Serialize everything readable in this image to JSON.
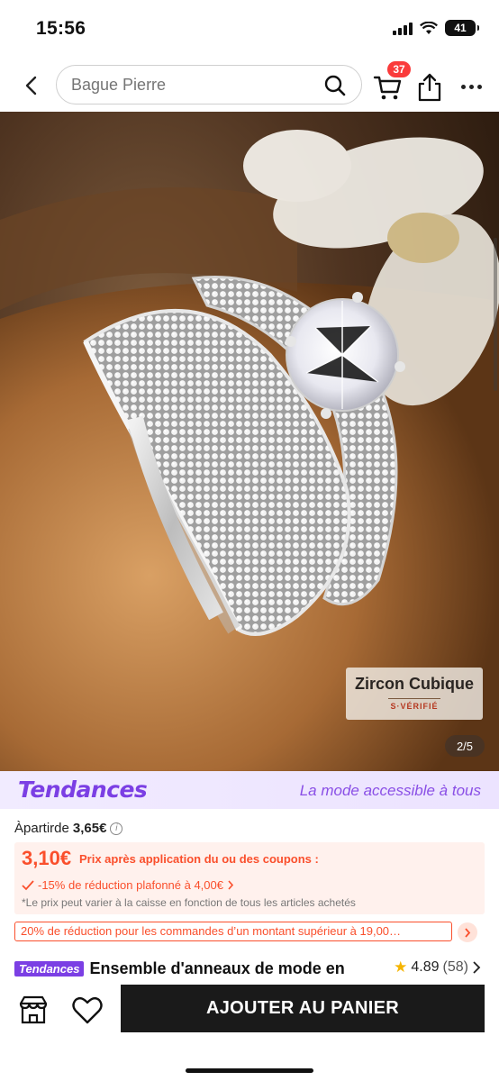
{
  "status": {
    "time": "15:56",
    "battery": "41"
  },
  "header": {
    "search_placeholder": "Bague Pierre",
    "cart_count": "37"
  },
  "gallery": {
    "badge_title": "Zircon Cubique",
    "badge_sub": "S·VÉRIFIÉ",
    "counter": "2/5"
  },
  "brand": {
    "logo": "Tendances",
    "tagline": "La mode accessible à tous"
  },
  "price": {
    "from_label": "Àpartirde",
    "from_value": "3,65€",
    "info_icon": "i",
    "coupon_price": "3,10€",
    "coupon_label": "Prix après application du ou des coupons :",
    "coupon_discount": "-15% de réduction plafonné à 4,00€",
    "coupon_note": "*Le prix peut varier à la caisse en fonction de tous les articles achetés",
    "promo": "20% de réduction pour les commandes d’un montant supérieur à 19,00…"
  },
  "product": {
    "brand_tag": "Tendances",
    "title": "Ensemble d'anneaux de mode en",
    "rating": "4.89",
    "reviews": "(58)"
  },
  "actions": {
    "add_to_cart": "AJOUTER AU PANIER"
  },
  "colors": {
    "accent": "#fa4f2c",
    "brand": "#7b3fe4",
    "cta": "#1a1a1a"
  }
}
